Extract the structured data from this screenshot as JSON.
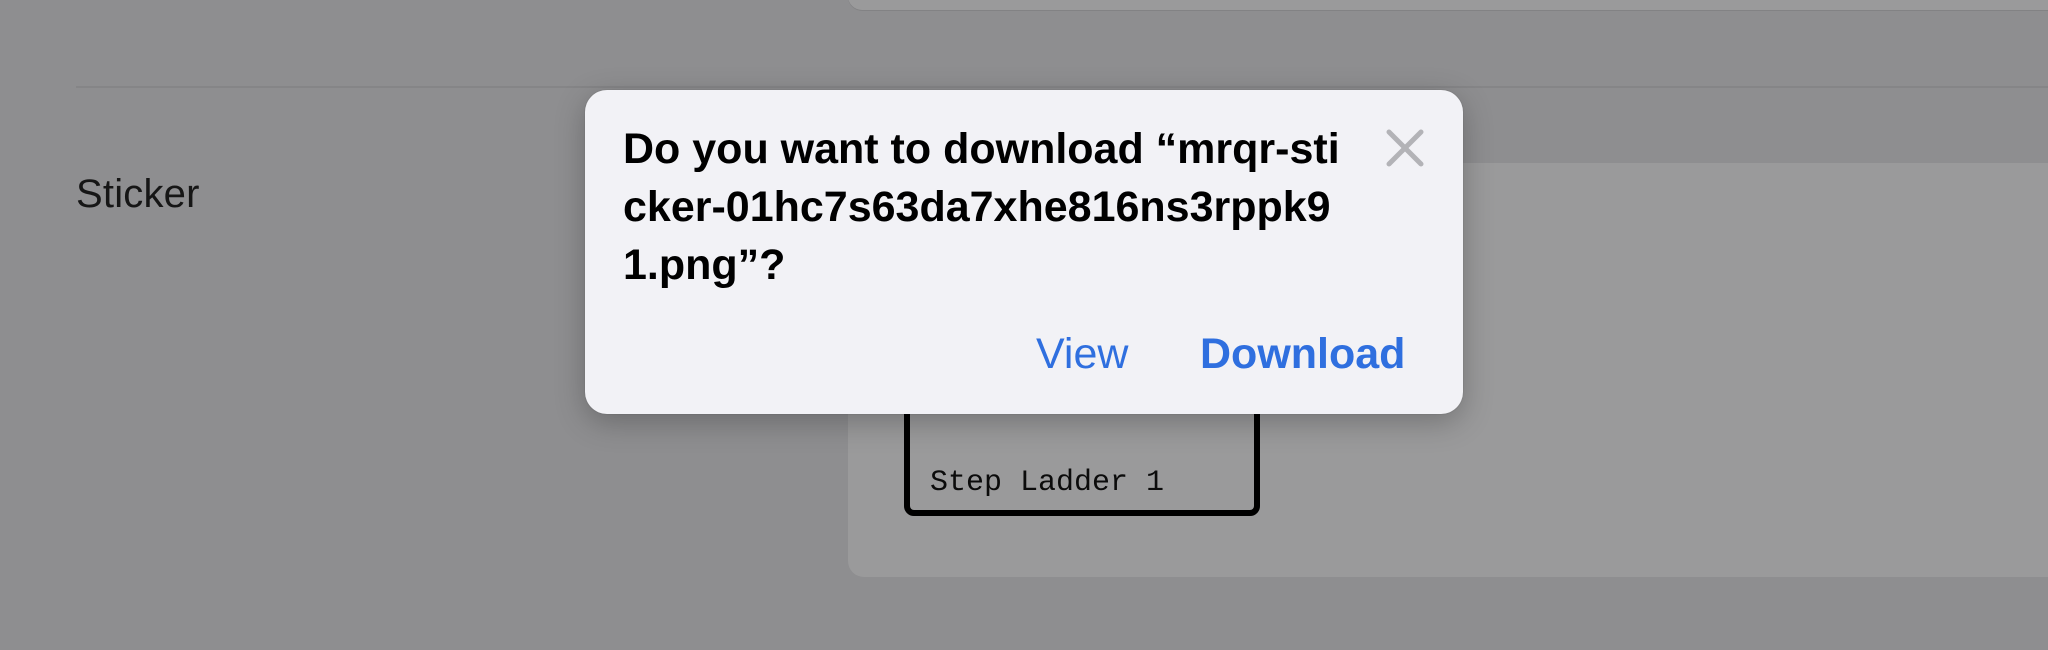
{
  "page": {
    "row_label": "Sticker",
    "sticker_preview_text": "Step Ladder 1"
  },
  "dialog": {
    "title": "Do you want to download “mrqr-sticker-01hc7s63da7xhe816ns3rppk91.png”?",
    "close_icon": "close-icon",
    "view_label": "View",
    "download_label": "Download"
  },
  "colors": {
    "backdrop": "#8e8e90",
    "dialog_bg": "#f2f2f6",
    "accent": "#2f6fdf",
    "close_icon": "#b3b3b7"
  }
}
